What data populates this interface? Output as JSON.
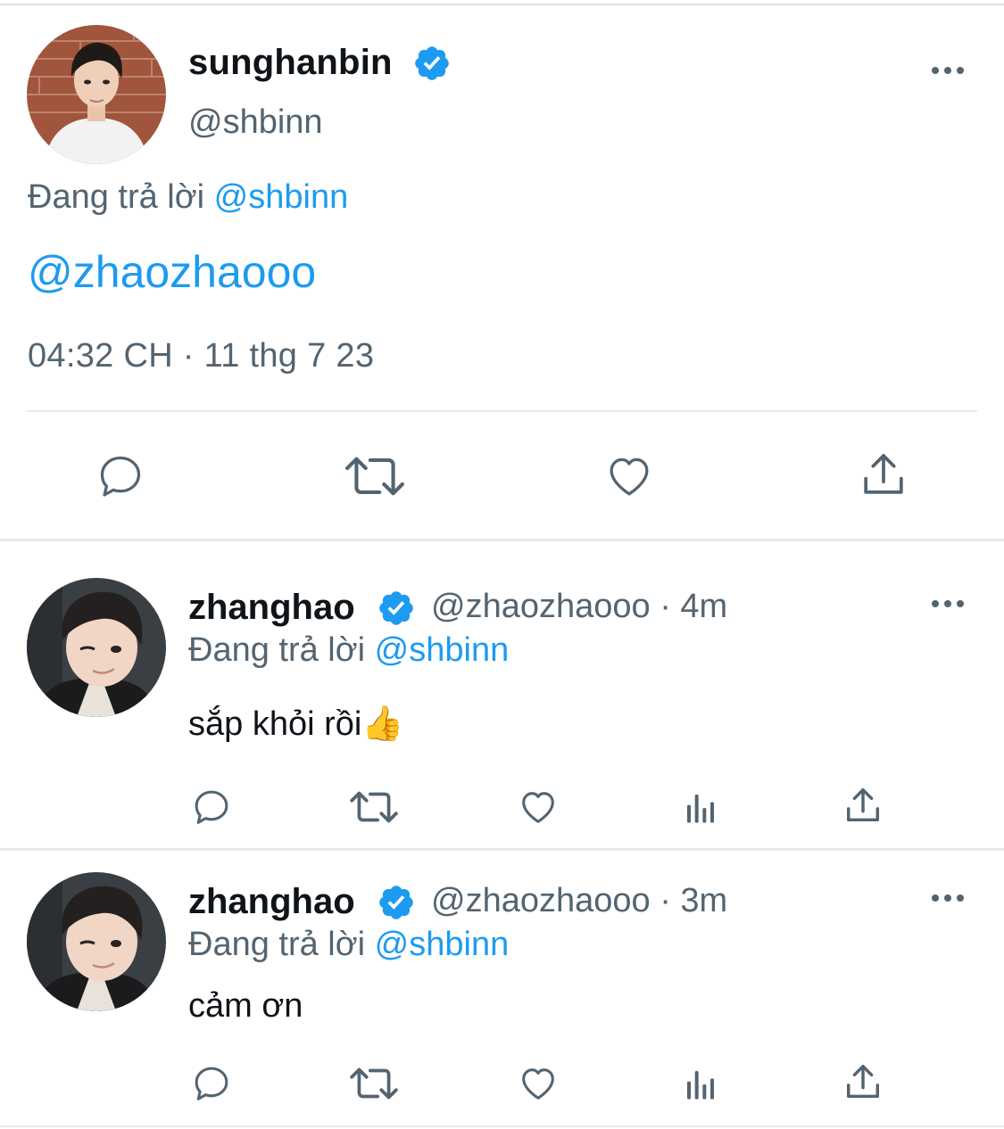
{
  "main_tweet": {
    "display_name": "sunghanbin",
    "handle": "@shbinn",
    "replying_prefix": "Đang trả lời",
    "replying_to": "@shbinn",
    "text": "@zhaozhaooo",
    "timestamp": "04:32 CH · 11 thg 7 23",
    "actions": [
      "reply",
      "retweet",
      "like",
      "share"
    ]
  },
  "replies": [
    {
      "display_name": "zhanghao",
      "handle_meta": "@zhaozhaooo · 4m",
      "replying_prefix": "Đang trả lời",
      "replying_to": "@shbinn",
      "text": "sắp khỏi rồi👍"
    },
    {
      "display_name": "zhanghao",
      "handle_meta": "@zhaozhaooo · 3m",
      "replying_prefix": "Đang trả lời",
      "replying_to": "@shbinn",
      "text": "cảm ơn"
    }
  ],
  "icons": {
    "verified": "verified-badge-icon",
    "more": "more-options-icon",
    "reply": "reply-icon",
    "retweet": "retweet-icon",
    "like": "like-icon",
    "views": "views-icon",
    "share": "share-icon"
  },
  "colors": {
    "accent": "#1d9bf0",
    "text": "#0f1419",
    "secondary": "#536471",
    "divider": "#e6e9eb"
  }
}
